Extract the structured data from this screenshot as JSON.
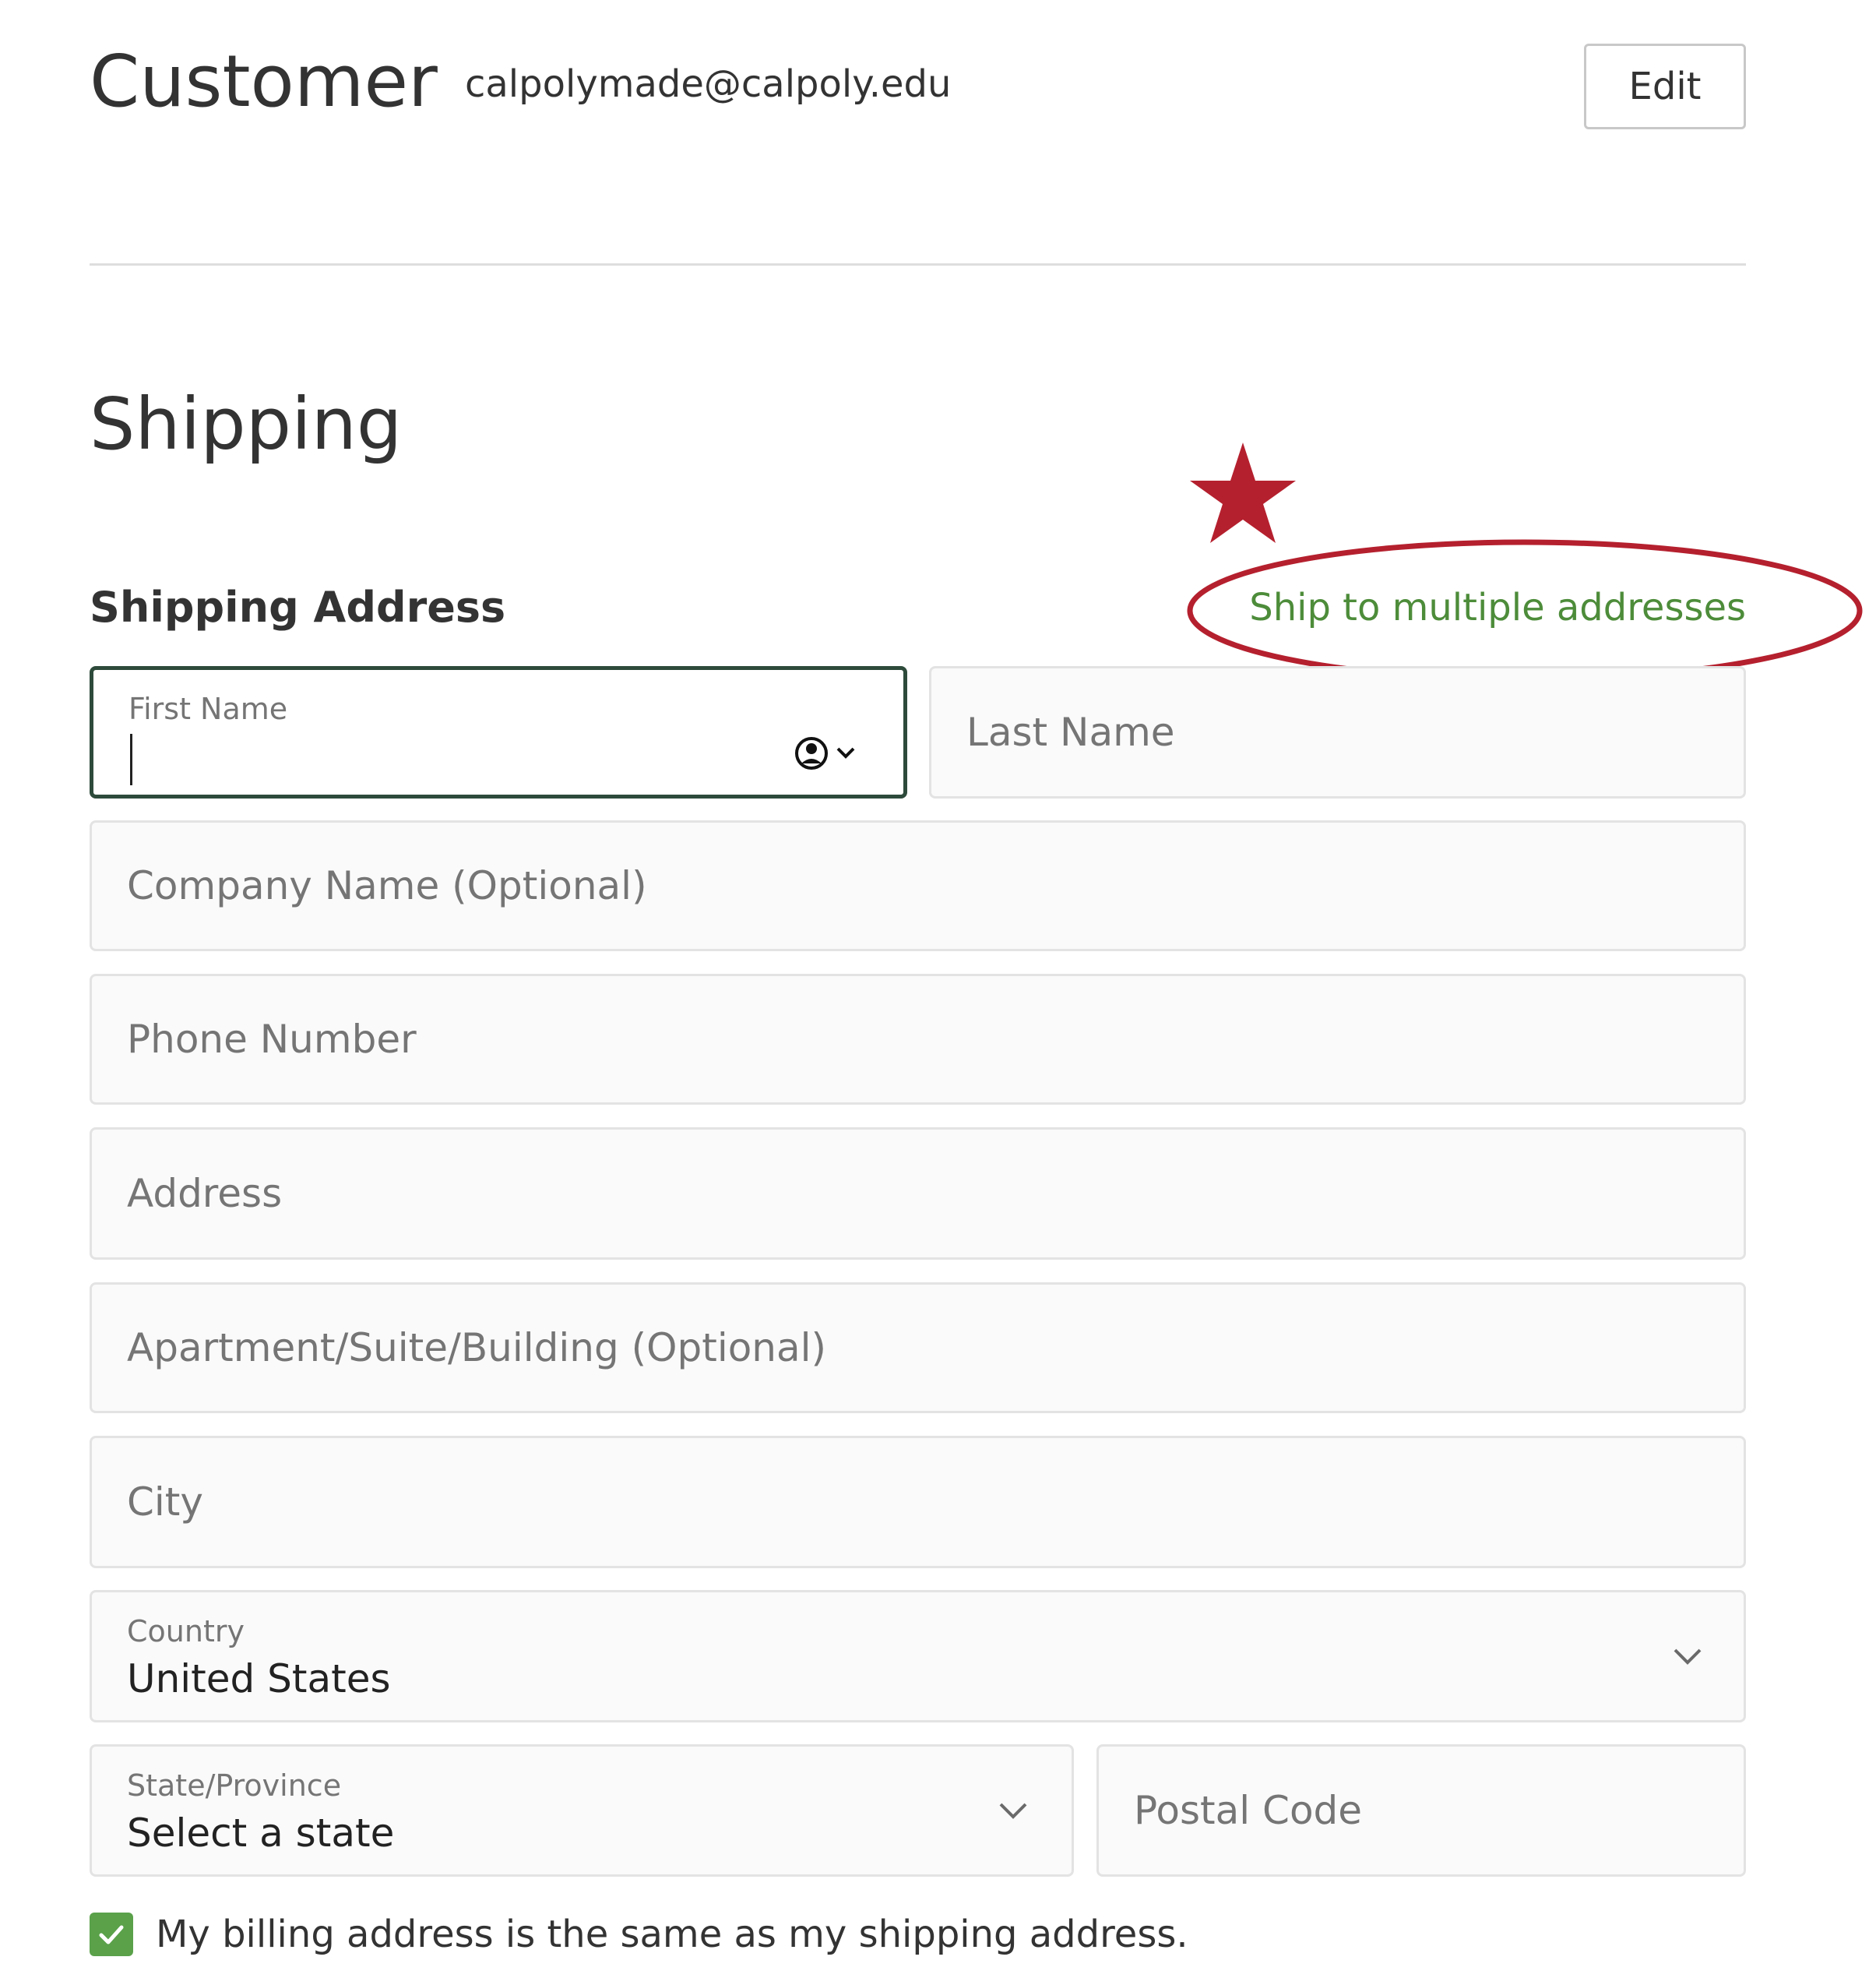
{
  "customer": {
    "title": "Customer",
    "email": "calpolymade@calpoly.edu",
    "edit_label": "Edit"
  },
  "shipping": {
    "title": "Shipping",
    "address_heading": "Shipping Address",
    "multi_address_link": "Ship to multiple addresses",
    "fields": {
      "first_name": {
        "label": "First Name",
        "value": ""
      },
      "last_name": {
        "placeholder": "Last Name"
      },
      "company": {
        "placeholder": "Company Name (Optional)"
      },
      "phone": {
        "placeholder": "Phone Number"
      },
      "address": {
        "placeholder": "Address"
      },
      "apartment": {
        "placeholder": "Apartment/Suite/Building (Optional)"
      },
      "city": {
        "placeholder": "City"
      },
      "country": {
        "label": "Country",
        "value": "United States"
      },
      "state": {
        "label": "State/Province",
        "value": "Select a state"
      },
      "postal_code": {
        "placeholder": "Postal Code"
      }
    },
    "billing_same": {
      "checked": true,
      "label": "My billing address is the same as my shipping address."
    }
  },
  "colors": {
    "accent_green": "#4d8c3a",
    "checkbox_green": "#5aa14a",
    "focus_border": "#2d4a3a",
    "annotation_red": "#b5202e"
  },
  "icons": [
    "user-circle-icon",
    "chevron-down-icon",
    "check-icon",
    "star-icon"
  ]
}
